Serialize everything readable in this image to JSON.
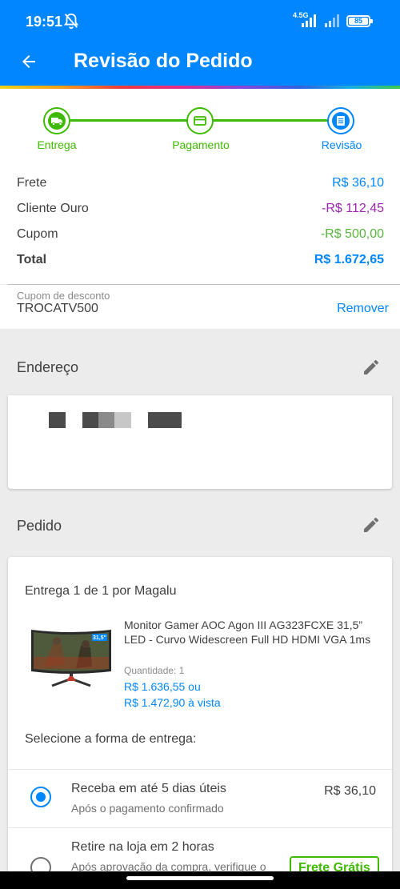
{
  "status_bar": {
    "time": "19:51",
    "network_type": "4.5G",
    "battery": "85"
  },
  "header": {
    "title": "Revisão do Pedido",
    "background_color": "#0086ff"
  },
  "stepper": {
    "steps": [
      {
        "label": "Entrega",
        "icon": "truck-icon",
        "state": "done"
      },
      {
        "label": "Pagamento",
        "icon": "card-icon",
        "state": "done"
      },
      {
        "label": "Revisão",
        "icon": "list-icon",
        "state": "active"
      }
    ],
    "done_color": "#3ebb00",
    "active_color": "#0086ff"
  },
  "summary": {
    "rows": [
      {
        "label": "Frete",
        "value": "R$ 36,10"
      },
      {
        "label": "Cliente Ouro",
        "value": "-R$ 112,45"
      },
      {
        "label": "Cupom",
        "value": "-R$ 500,00"
      },
      {
        "label": "Total",
        "value": "R$ 1.672,65"
      }
    ]
  },
  "coupon": {
    "label": "Cupom de desconto",
    "code": "TROCATV500",
    "remove_label": "Remover"
  },
  "address": {
    "title": "Endereço"
  },
  "order": {
    "title": "Pedido",
    "delivery_title": "Entrega 1 de 1 por Magalu",
    "product": {
      "name": "Monitor Gamer AOC Agon III AG323FCXE 31,5” LED - Curvo Widescreen Full HD HDMI VGA 1ms",
      "quantity_label": "Quantidade:  1",
      "price_installments": "R$ 1.636,55 ou",
      "price_cash": "R$ 1.472,90 à vista",
      "image_badge": "31,5\""
    },
    "select_delivery_label": "Selecione a forma de entrega:",
    "delivery_options": [
      {
        "title": "Receba em até 5 dias úteis",
        "subtitle": "Após o pagamento confirmado",
        "price": "R$ 36,10",
        "selected": true
      },
      {
        "title": "Retire na loja em 2 horas",
        "subtitle": "Após aprovação da compra, verifique o",
        "price": "Frete Grátis",
        "selected": false
      }
    ]
  }
}
